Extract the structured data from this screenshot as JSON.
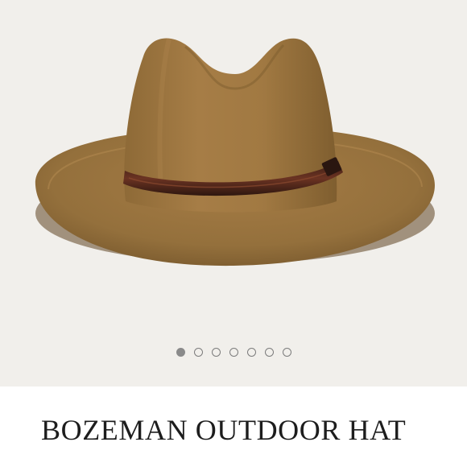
{
  "product": {
    "title": "BOZEMAN OUTDOOR HAT",
    "image_subject": "brown felt outdoor hat with leather band"
  },
  "carousel": {
    "total": 7,
    "active_index": 0
  },
  "colors": {
    "background": "#f1efeb",
    "hat_felt": "#9c7540",
    "hat_shadow": "#6d4f26",
    "band_leather": "#5a2a1c",
    "dot_active": "#8a8a8a",
    "dot_inactive_border": "#7c7c7c",
    "title_text": "#1d1d1d"
  }
}
